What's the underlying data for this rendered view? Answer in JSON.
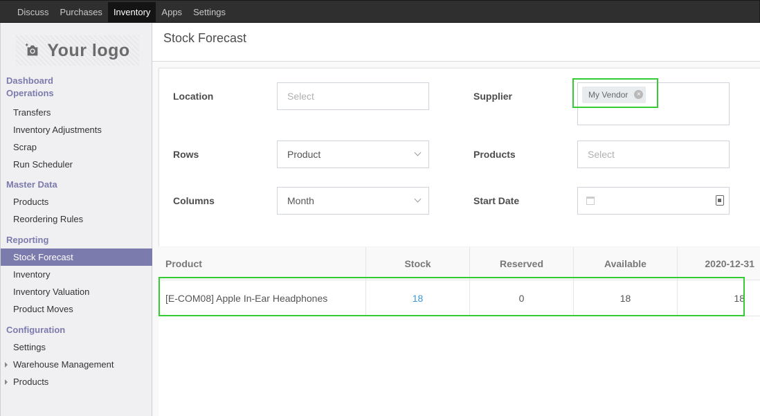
{
  "topbar": {
    "menu": [
      {
        "label": "Discuss",
        "active": false
      },
      {
        "label": "Purchases",
        "active": false
      },
      {
        "label": "Inventory",
        "active": true
      },
      {
        "label": "Apps",
        "active": false
      },
      {
        "label": "Settings",
        "active": false
      }
    ]
  },
  "sidebar": {
    "logo_text": "Your logo",
    "sections": {
      "dashboard": "Dashboard",
      "operations": "Operations",
      "master_data": "Master Data",
      "reporting": "Reporting",
      "configuration": "Configuration"
    },
    "operations_items": [
      "Transfers",
      "Inventory Adjustments",
      "Scrap",
      "Run Scheduler"
    ],
    "master_data_items": [
      "Products",
      "Reordering Rules"
    ],
    "reporting_items": [
      "Stock Forecast",
      "Inventory",
      "Inventory Valuation",
      "Product Moves"
    ],
    "configuration_items": [
      "Settings",
      "Warehouse Management",
      "Products"
    ],
    "active_item": "Stock Forecast"
  },
  "page": {
    "title": "Stock Forecast"
  },
  "form": {
    "location": {
      "label": "Location",
      "placeholder": "Select"
    },
    "supplier": {
      "label": "Supplier",
      "tag": "My Vendor"
    },
    "rows": {
      "label": "Rows",
      "value": "Product"
    },
    "products": {
      "label": "Products",
      "placeholder": "Select"
    },
    "columns": {
      "label": "Columns",
      "value": "Month"
    },
    "start_date": {
      "label": "Start Date",
      "value": ""
    }
  },
  "table": {
    "headers": [
      "Product",
      "Stock",
      "Reserved",
      "Available",
      "2020-12-31"
    ],
    "rows": [
      {
        "product": "[E-COM08] Apple In-Ear Headphones",
        "stock": "18",
        "reserved": "0",
        "available": "18",
        "d20201231": "18"
      }
    ]
  },
  "colors": {
    "accent": "#7c7bad",
    "link": "#3c96d6",
    "highlight": "#33cc33",
    "navbar": "#2f2f2f"
  }
}
